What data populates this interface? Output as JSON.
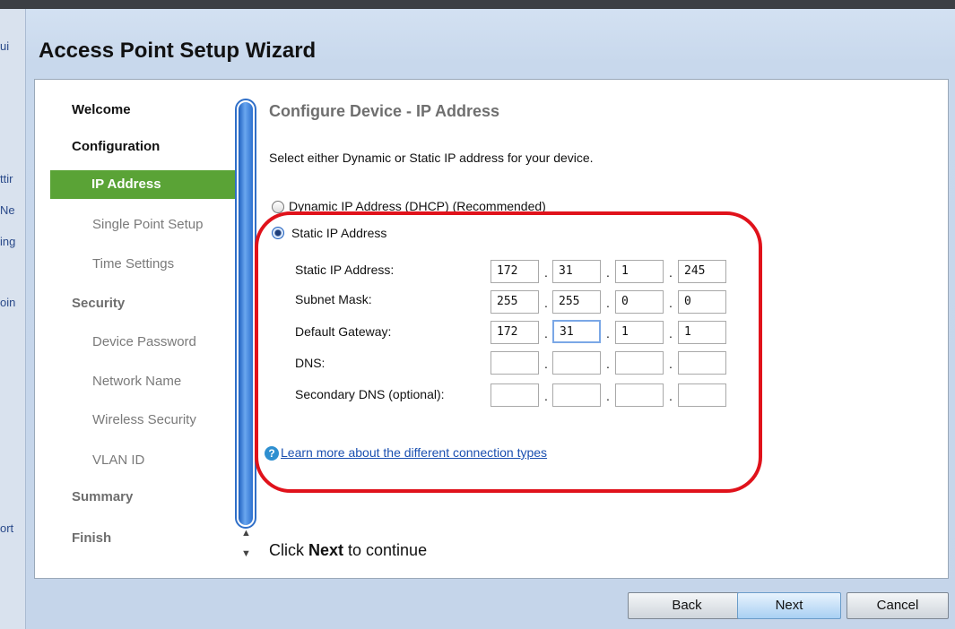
{
  "wizard": {
    "title": "Access Point Setup Wizard"
  },
  "background_fragments": [
    "ui",
    "ttir",
    "Ne",
    "ing",
    "oin",
    "ort"
  ],
  "nav": {
    "welcome": "Welcome",
    "configuration": "Configuration",
    "ip_address": "IP Address",
    "single_point_setup": "Single Point Setup",
    "time_settings": "Time Settings",
    "security": "Security",
    "device_password": "Device Password",
    "network_name": "Network Name",
    "wireless_security": "Wireless Security",
    "vlan_id": "VLAN ID",
    "summary": "Summary",
    "finish": "Finish"
  },
  "main": {
    "section_title": "Configure Device - IP Address",
    "instruction": "Select either Dynamic or Static IP address for your device.",
    "radio_dynamic": "Dynamic IP Address (DHCP) (Recommended)",
    "radio_static": "Static IP Address",
    "selected_mode": "static",
    "fields": {
      "static_ip_label": "Static IP Address:",
      "static_ip": [
        "172",
        "31",
        "1",
        "245"
      ],
      "subnet_label": "Subnet Mask:",
      "subnet": [
        "255",
        "255",
        "0",
        "0"
      ],
      "gateway_label": "Default Gateway:",
      "gateway": [
        "172",
        "31",
        "1",
        "1"
      ],
      "dns_label": "DNS:",
      "dns": [
        "",
        "",
        "",
        ""
      ],
      "secondary_dns_label": "Secondary DNS (optional):",
      "secondary_dns": [
        "",
        "",
        "",
        ""
      ]
    },
    "help_icon_glyph": "?",
    "help_link": "Learn more about the different connection types",
    "continue_prefix": "Click ",
    "continue_bold": "Next",
    "continue_suffix": " to continue"
  },
  "buttons": {
    "back": "Back",
    "next": "Next",
    "cancel": "Cancel"
  },
  "colors": {
    "active_nav": "#5aa336",
    "annotation": "#e0121b",
    "link": "#1a4fb0"
  }
}
